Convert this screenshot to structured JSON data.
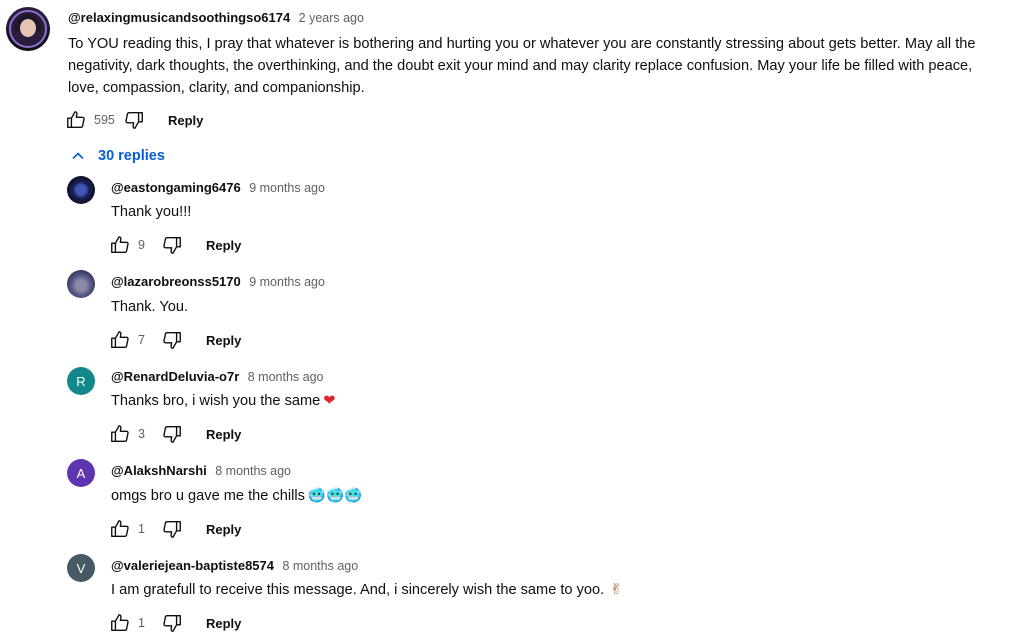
{
  "top_comment": {
    "handle": "@relaxingmusicandsoothingso6174",
    "time": "2 years ago",
    "text_line1": "To YOU reading this, I pray that whatever is bothering and hurting you or whatever you are constantly stressing about gets better. May all the",
    "text_line2": "negativity, dark thoughts, the overthinking, and the doubt exit your mind and may clarity replace confusion. May your life be filled with peace,",
    "text_line3": "love, compassion, clarity, and companionship.",
    "likes": "595",
    "reply_label": "Reply"
  },
  "replies_toggle": {
    "label": "30 replies",
    "icon": "chevron-up-icon"
  },
  "replies": [
    {
      "handle": "@eastongaming6476",
      "time": "9 months ago",
      "text": "Thank you!!!",
      "likes": "9",
      "reply_label": "Reply",
      "avatar": "image"
    },
    {
      "handle": "@lazarobreonss5170",
      "time": "9 months ago",
      "text": "Thank. You.",
      "likes": "7",
      "reply_label": "Reply",
      "avatar": "image"
    },
    {
      "handle": "@RenardDeluvia-o7r",
      "time": "8 months ago",
      "text": "Thanks bro, i wish you the same",
      "emoji": "❤",
      "likes": "3",
      "reply_label": "Reply",
      "avatar_letter": "R"
    },
    {
      "handle": "@AlakshNarshi",
      "time": "8 months ago",
      "text": "omgs bro u gave me the chills",
      "emoji": "🥶🥶🥶",
      "likes": "1",
      "reply_label": "Reply",
      "avatar_letter": "A"
    },
    {
      "handle": "@valeriejean-baptiste8574",
      "time": "8 months ago",
      "text": "I am gratefull to receive this message. And, i sincerely wish the same to yoo.",
      "emoji": "✌",
      "likes": "1",
      "reply_label": "Reply",
      "avatar_letter": "V"
    }
  ],
  "colors": {
    "link_blue": "#065fd4",
    "secondary_text": "#606060",
    "heart_red": "#e0242b"
  }
}
